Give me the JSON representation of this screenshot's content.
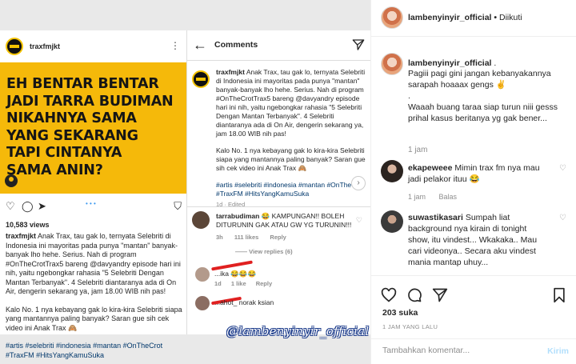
{
  "image": {
    "left_post": {
      "username": "traxfmjkt",
      "headline": "EH BENTAR BENTAR\nJADI TARRA BUDIMAN\nNIKAHNYA SAMA\nYANG SEKARANG\nTAPI CINTANYA\nSAMA ANIN?",
      "views": "10,583 views",
      "caption_user": "traxfmjkt",
      "caption_p1": "Anak Trax, tau gak lo, ternyata Selebriti di Indonesia ini mayoritas pada punya \"mantan\" banyak-banyak lho hehe. Serius. Nah di program #OnTheCrotTrax5 bareng @davyandry episode hari ini nih, yaitu ngebongkar rahasia \"5 Selebriti Dengan Mantan Terbanyak\". 4 Selebriti diantaranya ada di On Air, dengerin sekarang ya, jam 18.00 WIB nih pas!",
      "caption_p2": "Kalo No. 1 nya kebayang gak lo kira-kira Selebriti siapa yang mantannya paling banyak? Saran gue sih cek video ini Anak Trax 🙈",
      "caption_tags": "#artis #selebriti #indonesia #mantan #OnTheCrot #TraxFM #HitsYangKamuSuka"
    },
    "comments_screen": {
      "title": "Comments",
      "caption_user": "traxfmjkt",
      "caption_p1": "Anak Trax, tau gak lo, ternyata Selebriti di Indonesia ini mayoritas pada punya \"mantan\" banyak-banyak lho hehe. Serius. Nah di program #OnTheCrotTrax5 bareng @davyandry episode hari ini nih, yaitu ngebongkar rahasia \"5 Selebriti Dengan Mantan Terbanyak\". 4 Selebriti diantaranya ada di On Air, dengerin sekarang ya, jam 18.00 WIB nih pas!",
      "caption_p2": "Kalo No. 1 nya kebayang gak lo kira-kira Selebriti siapa yang mantannya paling banyak? Saran gue sih cek video ini Anak Trax 🙈",
      "caption_tags": "#artis #selebriti #indonesia #mantan #OnTheCrot #TraxFM #HitsYangKamuSuka",
      "edited": "1d · Edited",
      "comment_user": "tarrabudiman",
      "comment_text": "KAMPUNGAN!! BOLEH DITURUNIN GAK ATAU GW YG TURUNIN!!!",
      "comment_time": "3h",
      "comment_likes": "111 likes",
      "comment_reply": "Reply",
      "view_replies": "View replies (6)",
      "reply1_text": "...ika 😂😂😂",
      "reply1_time": "1d",
      "reply1_likes": "1 like",
      "reply1_reply": "Reply",
      "reply2_text": "...ahot_ norak ksian"
    },
    "watermark": "@lambenyinyir_official"
  },
  "panel": {
    "header": {
      "username": "lambenyinyir_official",
      "separator": "•",
      "follow_status": "Diikuti"
    },
    "post": {
      "username": "lambenyinyir_official",
      "caption_suffix": ".",
      "caption_l1": "Pagiii pagi gini jangan kebanyakannya sarapah hoaaax gengs ✌",
      "caption_l2": ".",
      "caption_l3": "Waaah buang taraa siap turun niii gesss prihal kasus beritanya yg gak bener...",
      "time": "1 jam"
    },
    "comments": [
      {
        "username": "ekapeweee",
        "text": "Mimin trax fm nya mau jadi pelakor ituu 😂",
        "time": "1 jam",
        "reply_label": "Balas"
      },
      {
        "username": "suwastikasari",
        "text": "Sumpah liat background nya kirain di tonight show, itu vindest... Wkakaka.. Mau cari videonya.. Secara aku vindest mania mantap uhuy...",
        "time": "",
        "reply_label": ""
      }
    ],
    "likes": "203 suka",
    "posted_ago": "1 JAM YANG LALU",
    "comment_placeholder": "Tambahkan komentar...",
    "post_button": "Kirim"
  }
}
